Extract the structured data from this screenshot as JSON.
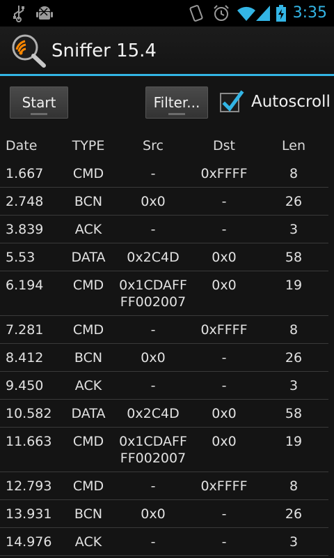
{
  "status_bar": {
    "time": "3:35",
    "icons": [
      "usb-icon",
      "android-debug-icon",
      "vibrate-icon",
      "alarm-icon",
      "wifi-icon",
      "signal-icon",
      "battery-charging-icon"
    ]
  },
  "action_bar": {
    "title": "Sniffer 15.4",
    "logo_icon": "sniffer-logo-icon"
  },
  "controls": {
    "start_label": "Start",
    "filter_label": "Filter...",
    "autoscroll_label": "Autoscroll",
    "autoscroll_checked": true
  },
  "colors": {
    "accent": "#33b5e5",
    "background": "#141414"
  },
  "table": {
    "headers": {
      "date": "Date",
      "type": "TYPE",
      "src": "Src",
      "dst": "Dst",
      "len": "Len"
    },
    "rows": [
      {
        "date": "1.667",
        "type": "CMD",
        "src": "-",
        "dst": "0xFFFF",
        "len": "8"
      },
      {
        "date": "2.748",
        "type": "BCN",
        "src": "0x0",
        "dst": "-",
        "len": "26"
      },
      {
        "date": "3.839",
        "type": "ACK",
        "src": "-",
        "dst": "-",
        "len": "3"
      },
      {
        "date": "5.53",
        "type": "DATA",
        "src": "0x2C4D",
        "dst": "0x0",
        "len": "58"
      },
      {
        "date": "6.194",
        "type": "CMD",
        "src": "0x1CDAFF\nFF002007",
        "dst": "0x0",
        "len": "19"
      },
      {
        "date": "7.281",
        "type": "CMD",
        "src": "-",
        "dst": "0xFFFF",
        "len": "8"
      },
      {
        "date": "8.412",
        "type": "BCN",
        "src": "0x0",
        "dst": "-",
        "len": "26"
      },
      {
        "date": "9.450",
        "type": "ACK",
        "src": "-",
        "dst": "-",
        "len": "3"
      },
      {
        "date": "10.582",
        "type": "DATA",
        "src": "0x2C4D",
        "dst": "0x0",
        "len": "58"
      },
      {
        "date": "11.663",
        "type": "CMD",
        "src": "0x1CDAFF\nFF002007",
        "dst": "0x0",
        "len": "19"
      },
      {
        "date": "12.793",
        "type": "CMD",
        "src": "-",
        "dst": "0xFFFF",
        "len": "8"
      },
      {
        "date": "13.931",
        "type": "BCN",
        "src": "0x0",
        "dst": "-",
        "len": "26"
      },
      {
        "date": "14.976",
        "type": "ACK",
        "src": "-",
        "dst": "-",
        "len": "3"
      }
    ]
  }
}
